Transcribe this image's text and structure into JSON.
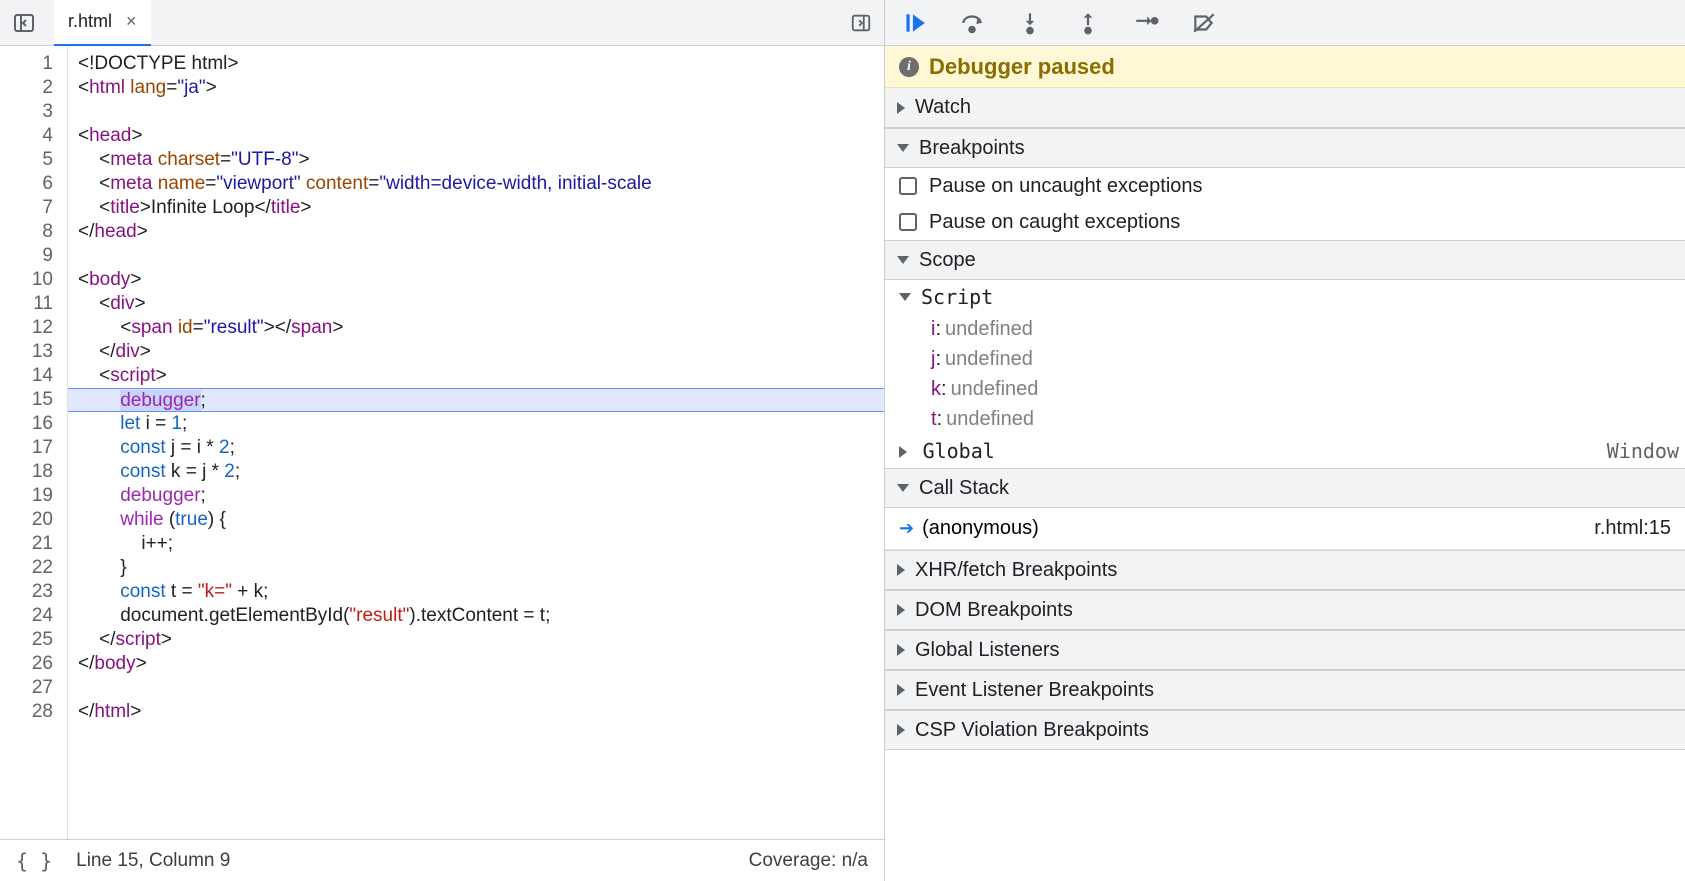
{
  "tabs": {
    "file_name": "r.html"
  },
  "editor": {
    "line_count": 28,
    "highlighted_line": 15,
    "tokens": [
      [
        {
          "c": "tok-doctype",
          "t": "<!DOCTYPE html>"
        }
      ],
      [
        {
          "c": "tok-punc",
          "t": "<"
        },
        {
          "c": "tok-tag",
          "t": "html"
        },
        {
          "c": "tok-punc",
          "t": " "
        },
        {
          "c": "tok-attr",
          "t": "lang"
        },
        {
          "c": "tok-punc",
          "t": "="
        },
        {
          "c": "tok-str",
          "t": "\"ja\""
        },
        {
          "c": "tok-punc",
          "t": ">"
        }
      ],
      [],
      [
        {
          "c": "tok-punc",
          "t": "<"
        },
        {
          "c": "tok-tag",
          "t": "head"
        },
        {
          "c": "tok-punc",
          "t": ">"
        }
      ],
      [
        {
          "c": "tok-punc",
          "t": "    <"
        },
        {
          "c": "tok-tag",
          "t": "meta"
        },
        {
          "c": "tok-punc",
          "t": " "
        },
        {
          "c": "tok-attr",
          "t": "charset"
        },
        {
          "c": "tok-punc",
          "t": "="
        },
        {
          "c": "tok-str",
          "t": "\"UTF-8\""
        },
        {
          "c": "tok-punc",
          "t": ">"
        }
      ],
      [
        {
          "c": "tok-punc",
          "t": "    <"
        },
        {
          "c": "tok-tag",
          "t": "meta"
        },
        {
          "c": "tok-punc",
          "t": " "
        },
        {
          "c": "tok-attr",
          "t": "name"
        },
        {
          "c": "tok-punc",
          "t": "="
        },
        {
          "c": "tok-str",
          "t": "\"viewport\""
        },
        {
          "c": "tok-punc",
          "t": " "
        },
        {
          "c": "tok-attr",
          "t": "content"
        },
        {
          "c": "tok-punc",
          "t": "="
        },
        {
          "c": "tok-str",
          "t": "\"width=device-width, initial-scale"
        }
      ],
      [
        {
          "c": "tok-punc",
          "t": "    <"
        },
        {
          "c": "tok-tag",
          "t": "title"
        },
        {
          "c": "tok-punc",
          "t": ">"
        },
        {
          "c": "tok-ident",
          "t": "Infinite Loop"
        },
        {
          "c": "tok-punc",
          "t": "</"
        },
        {
          "c": "tok-tag",
          "t": "title"
        },
        {
          "c": "tok-punc",
          "t": ">"
        }
      ],
      [
        {
          "c": "tok-punc",
          "t": "</"
        },
        {
          "c": "tok-tag",
          "t": "head"
        },
        {
          "c": "tok-punc",
          "t": ">"
        }
      ],
      [],
      [
        {
          "c": "tok-punc",
          "t": "<"
        },
        {
          "c": "tok-tag",
          "t": "body"
        },
        {
          "c": "tok-punc",
          "t": ">"
        }
      ],
      [
        {
          "c": "tok-punc",
          "t": "    <"
        },
        {
          "c": "tok-tag",
          "t": "div"
        },
        {
          "c": "tok-punc",
          "t": ">"
        }
      ],
      [
        {
          "c": "tok-punc",
          "t": "        <"
        },
        {
          "c": "tok-tag",
          "t": "span"
        },
        {
          "c": "tok-punc",
          "t": " "
        },
        {
          "c": "tok-attr",
          "t": "id"
        },
        {
          "c": "tok-punc",
          "t": "="
        },
        {
          "c": "tok-str",
          "t": "\"result\""
        },
        {
          "c": "tok-punc",
          "t": "></"
        },
        {
          "c": "tok-tag",
          "t": "span"
        },
        {
          "c": "tok-punc",
          "t": ">"
        }
      ],
      [
        {
          "c": "tok-punc",
          "t": "    </"
        },
        {
          "c": "tok-tag",
          "t": "div"
        },
        {
          "c": "tok-punc",
          "t": ">"
        }
      ],
      [
        {
          "c": "tok-punc",
          "t": "    <"
        },
        {
          "c": "tok-tag",
          "t": "script"
        },
        {
          "c": "tok-punc",
          "t": ">"
        }
      ],
      [
        {
          "c": "tok-punc",
          "t": "        "
        },
        {
          "c": "tok-kw debugger-hl",
          "t": "debugger"
        },
        {
          "c": "tok-punc",
          "t": ";"
        }
      ],
      [
        {
          "c": "tok-punc",
          "t": "        "
        },
        {
          "c": "tok-kw2",
          "t": "let"
        },
        {
          "c": "tok-punc",
          "t": " i = "
        },
        {
          "c": "tok-num",
          "t": "1"
        },
        {
          "c": "tok-punc",
          "t": ";"
        }
      ],
      [
        {
          "c": "tok-punc",
          "t": "        "
        },
        {
          "c": "tok-kw2",
          "t": "const"
        },
        {
          "c": "tok-punc",
          "t": " j = i * "
        },
        {
          "c": "tok-num",
          "t": "2"
        },
        {
          "c": "tok-punc",
          "t": ";"
        }
      ],
      [
        {
          "c": "tok-punc",
          "t": "        "
        },
        {
          "c": "tok-kw2",
          "t": "const"
        },
        {
          "c": "tok-punc",
          "t": " k = j * "
        },
        {
          "c": "tok-num",
          "t": "2"
        },
        {
          "c": "tok-punc",
          "t": ";"
        }
      ],
      [
        {
          "c": "tok-punc",
          "t": "        "
        },
        {
          "c": "tok-kw",
          "t": "debugger"
        },
        {
          "c": "tok-punc",
          "t": ";"
        }
      ],
      [
        {
          "c": "tok-punc",
          "t": "        "
        },
        {
          "c": "tok-kw",
          "t": "while"
        },
        {
          "c": "tok-punc",
          "t": " ("
        },
        {
          "c": "tok-lit",
          "t": "true"
        },
        {
          "c": "tok-punc",
          "t": ") {"
        }
      ],
      [
        {
          "c": "tok-punc",
          "t": "            i++;"
        }
      ],
      [
        {
          "c": "tok-punc",
          "t": "        }"
        }
      ],
      [
        {
          "c": "tok-punc",
          "t": "        "
        },
        {
          "c": "tok-kw2",
          "t": "const"
        },
        {
          "c": "tok-punc",
          "t": " t = "
        },
        {
          "c": "tok-strjs",
          "t": "\"k=\""
        },
        {
          "c": "tok-punc",
          "t": " + k;"
        }
      ],
      [
        {
          "c": "tok-punc",
          "t": "        document.getElementById("
        },
        {
          "c": "tok-strjs",
          "t": "\"result\""
        },
        {
          "c": "tok-punc",
          "t": ").textContent = t;"
        }
      ],
      [
        {
          "c": "tok-punc",
          "t": "    </"
        },
        {
          "c": "tok-tag",
          "t": "script"
        },
        {
          "c": "tok-punc",
          "t": ">"
        }
      ],
      [
        {
          "c": "tok-punc",
          "t": "</"
        },
        {
          "c": "tok-tag",
          "t": "body"
        },
        {
          "c": "tok-punc",
          "t": ">"
        }
      ],
      [],
      [
        {
          "c": "tok-punc",
          "t": "</"
        },
        {
          "c": "tok-tag",
          "t": "html"
        },
        {
          "c": "tok-punc",
          "t": ">"
        }
      ]
    ]
  },
  "status": {
    "pos_label": "Line 15, Column 9",
    "coverage_label": "Coverage: n/a"
  },
  "debugger": {
    "paused_label": "Debugger paused",
    "sections": {
      "watch": "Watch",
      "breakpoints": "Breakpoints",
      "scope": "Scope",
      "call_stack": "Call Stack",
      "xhr": "XHR/fetch Breakpoints",
      "dom_bp": "DOM Breakpoints",
      "global_listeners": "Global Listeners",
      "event_listener_bp": "Event Listener Breakpoints",
      "csp": "CSP Violation Breakpoints"
    },
    "breakpoints": {
      "uncaught": "Pause on uncaught exceptions",
      "caught": "Pause on caught exceptions"
    },
    "scope": {
      "script_label": "Script",
      "global_label": "Global",
      "global_value": "Window",
      "vars": [
        {
          "name": "i",
          "value": "undefined"
        },
        {
          "name": "j",
          "value": "undefined"
        },
        {
          "name": "k",
          "value": "undefined"
        },
        {
          "name": "t",
          "value": "undefined"
        }
      ]
    },
    "call_stack": {
      "frame_name": "(anonymous)",
      "frame_loc": "r.html:15"
    }
  }
}
